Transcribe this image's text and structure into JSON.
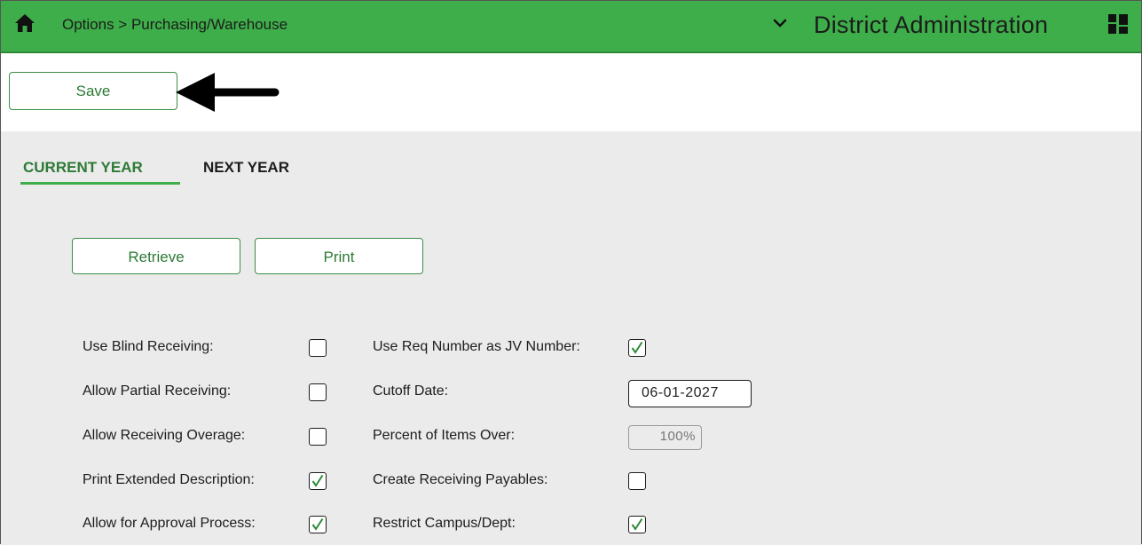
{
  "header": {
    "breadcrumb": "Options > Purchasing/Warehouse",
    "app_title": "District Administration",
    "home_icon": "home-icon",
    "chevron_icon": "chevron-down-icon",
    "grid_icon": "grid-icon",
    "bar_color": "#3dae49"
  },
  "toolbar": {
    "save_label": "Save"
  },
  "tabs": [
    {
      "label": "CURRENT YEAR",
      "active": true
    },
    {
      "label": "NEXT YEAR",
      "active": false
    }
  ],
  "actions": {
    "retrieve_label": "Retrieve",
    "print_label": "Print"
  },
  "form": {
    "left": [
      {
        "label": "Use Blind Receiving:",
        "checked": false
      },
      {
        "label": "Allow Partial Receiving:",
        "checked": false
      },
      {
        "label": "Allow Receiving Overage:",
        "checked": false
      },
      {
        "label": "Print Extended Description:",
        "checked": true
      },
      {
        "label": "Allow for Approval Process:",
        "checked": true
      }
    ],
    "right": [
      {
        "label": "Use Req Number as JV Number:",
        "checked": true
      },
      {
        "label": "Cutoff Date:",
        "value": "06-01-2027"
      },
      {
        "label": "Percent of Items Over:",
        "value": "100%",
        "disabled": true
      },
      {
        "label": "Create Receiving Payables:",
        "checked": false
      },
      {
        "label": "Restrict Campus/Dept:",
        "checked": true
      }
    ]
  }
}
